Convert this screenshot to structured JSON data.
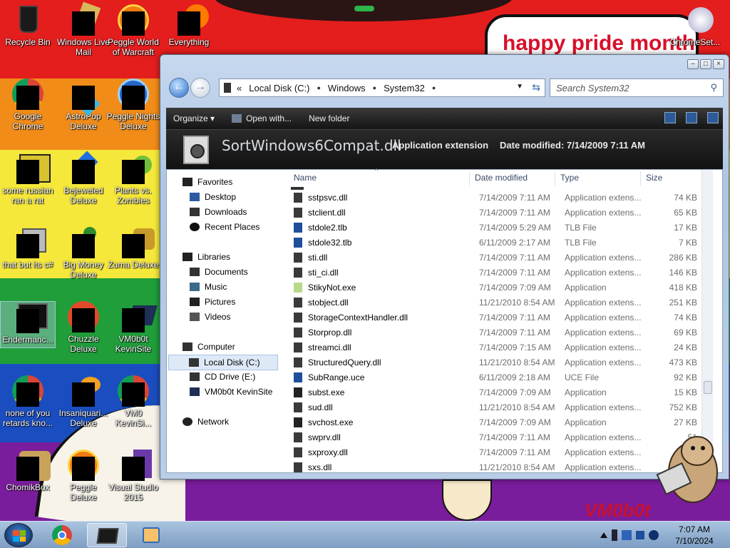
{
  "colors": {
    "accent": "#2b6cc4",
    "wallpaper_red": "#e41d1d",
    "wallpaper_orange": "#f28c18",
    "wallpaper_yellow": "#f5e83a",
    "wallpaper_green": "#1f9e3a",
    "wallpaper_blue": "#1a4ec0",
    "wallpaper_purple": "#7a1d9c",
    "pride_text": "#d8102a"
  },
  "wallpaper": {
    "pride_text": "happy pride month",
    "signature": "VM0b0t"
  },
  "desktop_icons": [
    {
      "label": "Recycle Bin",
      "icon": "recycle-bin-icon"
    },
    {
      "label": "Windows Live\nMail",
      "icon": "windows-live-mail-icon"
    },
    {
      "label": "Peggle World\nof Warcraft",
      "icon": "peggle-world-icon"
    },
    {
      "label": "Everything",
      "icon": "everything-icon"
    },
    {
      "label": "ChromeSet...",
      "icon": "chromeset-icon"
    },
    {
      "label": "Google\nChrome",
      "icon": "chrome-icon"
    },
    {
      "label": "AstroPop\nDeluxe",
      "icon": "astropop-icon"
    },
    {
      "label": "Peggle Nights\nDeluxe",
      "icon": "peggle-nights-icon"
    },
    {
      "label": "some russian\nran a rat",
      "icon": "ie-icon"
    },
    {
      "label": "Bejeweled\nDeluxe",
      "icon": "bejeweled-icon"
    },
    {
      "label": "Plants vs.\nZombies",
      "icon": "pvz-icon"
    },
    {
      "label": "that but its c#",
      "icon": "windows-icon"
    },
    {
      "label": "Big Money\nDeluxe",
      "icon": "big-money-icon"
    },
    {
      "label": "Zuma Deluxe",
      "icon": "zuma-icon"
    },
    {
      "label": "Endermanc...",
      "icon": "shortcut-icon"
    },
    {
      "label": "Chuzzle\nDeluxe",
      "icon": "chuzzle-icon"
    },
    {
      "label": "VM0b0t\nKevinSite",
      "icon": "folder-icon"
    },
    {
      "label": "none of you\nretards kno...",
      "icon": "chrome-icon"
    },
    {
      "label": "Insaniquari...\nDeluxe",
      "icon": "insaniquarium-icon"
    },
    {
      "label": "VM0\nKevinSi...",
      "icon": "chrome-icon"
    },
    {
      "label": "ChomikBox",
      "icon": "chomikbox-icon"
    },
    {
      "label": "Peggle Deluxe",
      "icon": "peggle-deluxe-icon"
    },
    {
      "label": "Visual Studio\n2015",
      "icon": "visual-studio-icon"
    }
  ],
  "window": {
    "address": {
      "segments": [
        "Local Disk (C:)",
        "Windows",
        "System32"
      ],
      "overflow": "«"
    },
    "search_placeholder": "Search System32",
    "toolbar": {
      "organize": "Organize ▾",
      "open_with": "Open with...",
      "new_folder": "New folder"
    },
    "details": {
      "filename": "SortWindows6Compat.dll",
      "type": "Application extension",
      "modified": "Date modified: 7/14/2009 7:11 AM"
    },
    "nav": {
      "favorites": "Favorites",
      "desktop": "Desktop",
      "downloads": "Downloads",
      "recent": "Recent Places",
      "libraries": "Libraries",
      "documents": "Documents",
      "music": "Music",
      "pictures": "Pictures",
      "videos": "Videos",
      "computer": "Computer",
      "local_disk": "Local Disk (C:)",
      "cd_drive": "CD Drive (E:)",
      "vm_site": "VM0b0t KevinSite",
      "network": "Network"
    },
    "columns": {
      "name": "Name",
      "date": "Date modified",
      "type": "Type",
      "size": "Size"
    },
    "files": [
      {
        "name": "sstpsvc.dll",
        "date": "7/14/2009 7:11 AM",
        "type": "Application extens...",
        "size": "74 KB",
        "icon": "dll-icon"
      },
      {
        "name": "stclient.dll",
        "date": "7/14/2009 7:11 AM",
        "type": "Application extens...",
        "size": "65 KB",
        "icon": "dll-icon"
      },
      {
        "name": "stdole2.tlb",
        "date": "7/14/2009 5:29 AM",
        "type": "TLB File",
        "size": "17 KB",
        "icon": "tlb-icon"
      },
      {
        "name": "stdole32.tlb",
        "date": "6/11/2009 2:17 AM",
        "type": "TLB File",
        "size": "7 KB",
        "icon": "tlb-icon"
      },
      {
        "name": "sti.dll",
        "date": "7/14/2009 7:11 AM",
        "type": "Application extens...",
        "size": "286 KB",
        "icon": "dll-icon"
      },
      {
        "name": "sti_ci.dll",
        "date": "7/14/2009 7:11 AM",
        "type": "Application extens...",
        "size": "146 KB",
        "icon": "dll-icon"
      },
      {
        "name": "StikyNot.exe",
        "date": "7/14/2009 7:09 AM",
        "type": "Application",
        "size": "418 KB",
        "icon": "sticky-notes-icon"
      },
      {
        "name": "stobject.dll",
        "date": "11/21/2010 8:54 AM",
        "type": "Application extens...",
        "size": "251 KB",
        "icon": "dll-icon"
      },
      {
        "name": "StorageContextHandler.dll",
        "date": "7/14/2009 7:11 AM",
        "type": "Application extens...",
        "size": "74 KB",
        "icon": "dll-icon"
      },
      {
        "name": "Storprop.dll",
        "date": "7/14/2009 7:11 AM",
        "type": "Application extens...",
        "size": "69 KB",
        "icon": "dll-icon"
      },
      {
        "name": "streamci.dll",
        "date": "7/14/2009 7:15 AM",
        "type": "Application extens...",
        "size": "24 KB",
        "icon": "dll-icon"
      },
      {
        "name": "StructuredQuery.dll",
        "date": "11/21/2010 8:54 AM",
        "type": "Application extens...",
        "size": "473 KB",
        "icon": "dll-icon"
      },
      {
        "name": "SubRange.uce",
        "date": "6/11/2009 2:18 AM",
        "type": "UCE File",
        "size": "92 KB",
        "icon": "uce-icon"
      },
      {
        "name": "subst.exe",
        "date": "7/14/2009 7:09 AM",
        "type": "Application",
        "size": "15 KB",
        "icon": "exe-icon"
      },
      {
        "name": "sud.dll",
        "date": "11/21/2010 8:54 AM",
        "type": "Application extens...",
        "size": "752 KB",
        "icon": "dll-icon"
      },
      {
        "name": "svchost.exe",
        "date": "7/14/2009 7:09 AM",
        "type": "Application",
        "size": "27 KB",
        "icon": "exe-icon"
      },
      {
        "name": "swprv.dll",
        "date": "7/14/2009 7:11 AM",
        "type": "Application extens...",
        "size": "51",
        "icon": "dll-icon"
      },
      {
        "name": "sxproxy.dll",
        "date": "7/14/2009 7:11 AM",
        "type": "Application extens...",
        "size": "",
        "icon": "dll-icon"
      },
      {
        "name": "sxs.dll",
        "date": "11/21/2010 8:54 AM",
        "type": "Application extens...",
        "size": "",
        "icon": "dll-icon"
      }
    ]
  },
  "taskbar": {
    "start_icon": "windows-start-icon",
    "pinned": [
      "chrome-icon",
      "explorer-icon",
      "media-player-icon"
    ],
    "tray_icons": [
      "show-hidden-icons-icon",
      "bluetooth-icon",
      "network-icon",
      "volume-icon"
    ],
    "time": "7:07 AM",
    "date": "7/10/2024"
  }
}
